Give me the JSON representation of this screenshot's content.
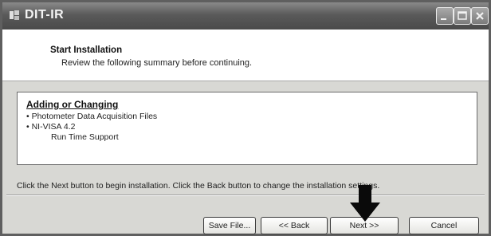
{
  "window": {
    "title": "DIT-IR"
  },
  "header": {
    "title": "Start Installation",
    "subtitle": "Review the following summary before continuing."
  },
  "summary": {
    "heading": "Adding or Changing",
    "items": [
      {
        "text": "• Photometer Data Acquisition Files"
      },
      {
        "text": "• NI-VISA 4.2"
      },
      {
        "text": "Run Time Support"
      }
    ]
  },
  "instruction": "Click the Next button to begin installation.  Click the Back button to change the installation settings.",
  "buttons": {
    "save_file": "Save File...",
    "back": "<< Back",
    "next": "Next >>",
    "cancel": "Cancel"
  },
  "icons": {
    "app": "installer-icon",
    "minimize": "minimize-icon",
    "maximize": "maximize-icon",
    "close": "close-icon",
    "pointer": "down-arrow-icon"
  }
}
